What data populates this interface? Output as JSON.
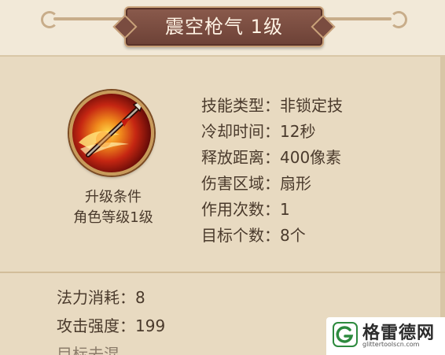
{
  "skill": {
    "title": "震空枪气 1级",
    "upgrade_condition": {
      "label": "升级条件",
      "requirement": "角色等级1级"
    },
    "stats": [
      {
        "label": "技能类型：",
        "value": "非锁定技"
      },
      {
        "label": "冷却时间：",
        "value": "12秒"
      },
      {
        "label": "释放距离：",
        "value": "400像素"
      },
      {
        "label": "伤害区域：",
        "value": "扇形"
      },
      {
        "label": "作用次数：",
        "value": "1"
      },
      {
        "label": "目标个数：",
        "value": "8个"
      }
    ],
    "costs": [
      {
        "label": "法力消耗：",
        "value": "8"
      },
      {
        "label": "攻击强度：",
        "value": "199"
      }
    ],
    "cut_off_text": "目标去混"
  },
  "watermark": {
    "name": "格雷德网",
    "url": "glittertoolscn.com"
  },
  "colors": {
    "panel_bg": "#e8dac1",
    "title_plate": "#7a4c40",
    "text": "#4a3a2c"
  },
  "icons": {
    "skill": "spear-slash-icon",
    "watermark_logo": "g-logo-icon"
  }
}
